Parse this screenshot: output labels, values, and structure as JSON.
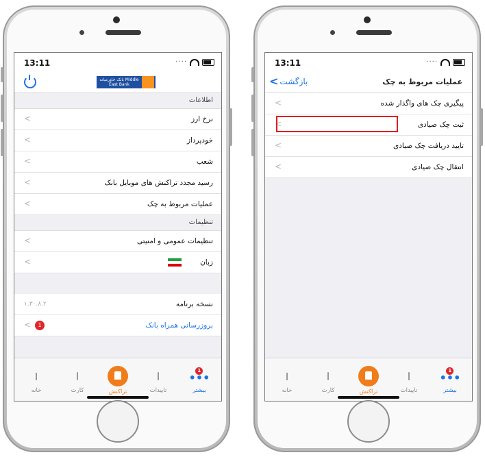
{
  "left_phone": {
    "status_time": "13:11",
    "logo_text": "بانک خاورمیانه Middle East Bank",
    "sections": [
      {
        "header": "اطلاعات",
        "rows": [
          {
            "label": "نرخ ارز"
          },
          {
            "label": "خودپرداز"
          },
          {
            "label": "شعب"
          },
          {
            "label": "رسید مجدد تراکنش های موبایل بانک"
          },
          {
            "label": "عملیات مربوط به چک"
          }
        ]
      },
      {
        "header": "تنظیمات",
        "rows": [
          {
            "label": "تنظیمات عمومی و امنیتی"
          },
          {
            "label": "زبان"
          }
        ]
      }
    ],
    "version_label": "نسخه برنامه",
    "version_value": "۱.۳۰.۸.۲",
    "update_label": "بروزرسانی همراه بانک",
    "update_badge": "1"
  },
  "right_phone": {
    "status_time": "13:11",
    "title": "عملیات مربوط به چک",
    "back_label": "بازگشت",
    "rows": [
      {
        "label": "پیگیری چک های واگذار شده"
      },
      {
        "label": "ثبت چک صیادی"
      },
      {
        "label": "تایید دریافت چک صیادی"
      },
      {
        "label": "انتقال چک صیادی"
      }
    ],
    "highlight_color": "#e01b22"
  },
  "tabs": {
    "home": "خانه",
    "card": "کارت",
    "transaction": "تراکنش",
    "approvals": "تاییدات",
    "more": "بیشتر",
    "more_badge": "1"
  },
  "colors": {
    "accent": "#1a73e8",
    "orange": "#f07c1a",
    "badge": "#e0262a"
  }
}
